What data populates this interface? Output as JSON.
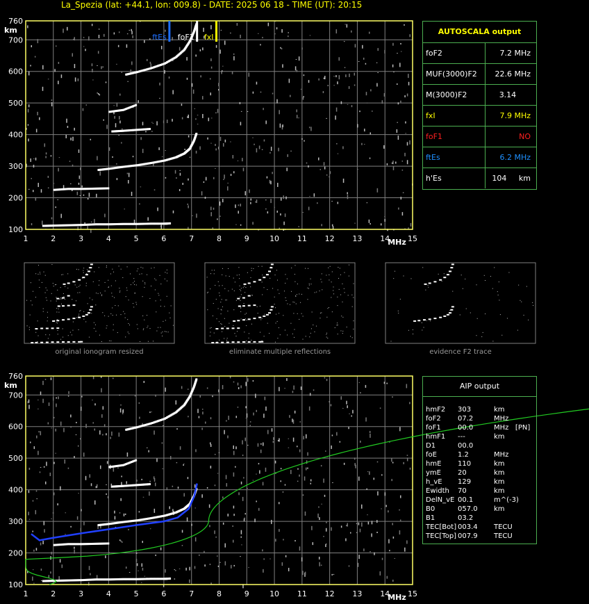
{
  "header": {
    "title": "La_Spezia (lat: +44.1, lon: 009.8) - DATE: 2025 06 18 - TIME (UT): 20:15"
  },
  "colors": {
    "grid": "#808080",
    "axis": "#ffff66",
    "panel_border": "#4caf50",
    "fxI": "#ffff00",
    "ftEs": "#1e6fff",
    "foF1": "#ff2020"
  },
  "chart_data": [
    {
      "type": "scatter",
      "name": "ionogram",
      "x_ticks": [
        "1",
        "2",
        "3",
        "4",
        "5",
        "6",
        "7",
        "8",
        "9",
        "10",
        "11",
        "12",
        "13",
        "14",
        "15"
      ],
      "y_ticks": [
        "100",
        "200",
        "300",
        "400",
        "500",
        "600",
        "700",
        "760"
      ],
      "xunit": "MHz",
      "yunit": "km",
      "xlim": [
        1,
        15
      ],
      "ylim": [
        100,
        760
      ],
      "grid": true,
      "markers": [
        {
          "label": "ftEs",
          "x": 6.2,
          "color": "#1e6fff"
        },
        {
          "label": "foF2",
          "x": 7.2,
          "color": "#ffffff"
        },
        {
          "label": "fxI",
          "x": 7.9,
          "color": "#ffff00"
        }
      ],
      "traces": [
        {
          "name": "Es",
          "x": [
            1.6,
            2.0,
            2.5,
            3.0,
            3.5,
            4.0,
            4.5,
            5.0,
            5.5,
            6.0,
            6.2
          ],
          "y": [
            111,
            112,
            113,
            114,
            116,
            116,
            117,
            117,
            118,
            118,
            119
          ]
        },
        {
          "name": "F2 O-trace",
          "x": [
            3.6,
            4.0,
            4.5,
            5.0,
            5.5,
            6.0,
            6.4,
            6.7,
            6.9,
            7.05,
            7.15
          ],
          "y": [
            288,
            292,
            298,
            303,
            310,
            318,
            328,
            340,
            355,
            380,
            405
          ]
        },
        {
          "name": "F2 2nd hop",
          "x": [
            4.6,
            5.0,
            5.5,
            6.0,
            6.4,
            6.7,
            6.9,
            7.05,
            7.15
          ],
          "y": [
            590,
            598,
            610,
            625,
            645,
            668,
            695,
            725,
            752
          ]
        },
        {
          "name": "2nd Es weak",
          "x": [
            2.0,
            2.5,
            3.0,
            3.5,
            4.0
          ],
          "y": [
            225,
            228,
            228,
            229,
            230
          ]
        },
        {
          "name": "multi",
          "x": [
            4.1,
            4.5,
            5.0,
            5.5
          ],
          "y": [
            410,
            412,
            415,
            418
          ]
        },
        {
          "name": "multi2",
          "x": [
            4.0,
            4.5,
            5.0
          ],
          "y": [
            472,
            478,
            495
          ]
        }
      ]
    }
  ],
  "thumbnails": {
    "captions": [
      "original ionogram resized",
      "eliminate multiple reflections",
      "evidence F2 trace"
    ]
  },
  "autoscala": {
    "title": "AUTOSCALA output",
    "rows": [
      {
        "label": "foF2",
        "value": "7.2 MHz",
        "color": "#ffffff"
      },
      {
        "label": "MUF(3000)F2",
        "value": "22.6 MHz",
        "color": "#ffffff"
      },
      {
        "label": "M(3000)F2",
        "value": "3.14",
        "color": "#ffffff"
      },
      {
        "label": "fxI",
        "value": "7.9 MHz",
        "color": "#ffff00"
      },
      {
        "label": "foF1",
        "value": "NO",
        "color": "#ff2020"
      },
      {
        "label": "ftEs",
        "value": "6.2 MHz",
        "color": "#1e90ff"
      },
      {
        "label": "h'Es",
        "value": "104     km",
        "color": "#ffffff"
      }
    ]
  },
  "aip": {
    "title": "AIP output",
    "rows": [
      {
        "name": "hmF2",
        "value": "303",
        "unit": "km"
      },
      {
        "name": "foF2",
        "value": "07.2",
        "unit": "MHz"
      },
      {
        "name": "foF1",
        "value": "00.0",
        "unit": "MHz   [PN]"
      },
      {
        "name": "hmF1",
        "value": "---",
        "unit": "km"
      },
      {
        "name": "D1",
        "value": "00.0",
        "unit": ""
      },
      {
        "name": "foE",
        "value": "1.2",
        "unit": "MHz"
      },
      {
        "name": "hmE",
        "value": "110",
        "unit": "km"
      },
      {
        "name": "ymE",
        "value": "20",
        "unit": "km"
      },
      {
        "name": "h_vE",
        "value": "129",
        "unit": "km"
      },
      {
        "name": "Ewidth",
        "value": "70",
        "unit": "km"
      },
      {
        "name": "DelN_vE",
        "value": "00.1",
        "unit": "m^(-3)"
      },
      {
        "name": "B0",
        "value": "057.0",
        "unit": "km"
      },
      {
        "name": "B1",
        "value": "03.2",
        "unit": ""
      },
      {
        "name": "TEC[Bot]",
        "value": "003.4",
        "unit": "TECU"
      },
      {
        "name": "TEC[Top]",
        "value": "007.9",
        "unit": "TECU"
      }
    ]
  }
}
